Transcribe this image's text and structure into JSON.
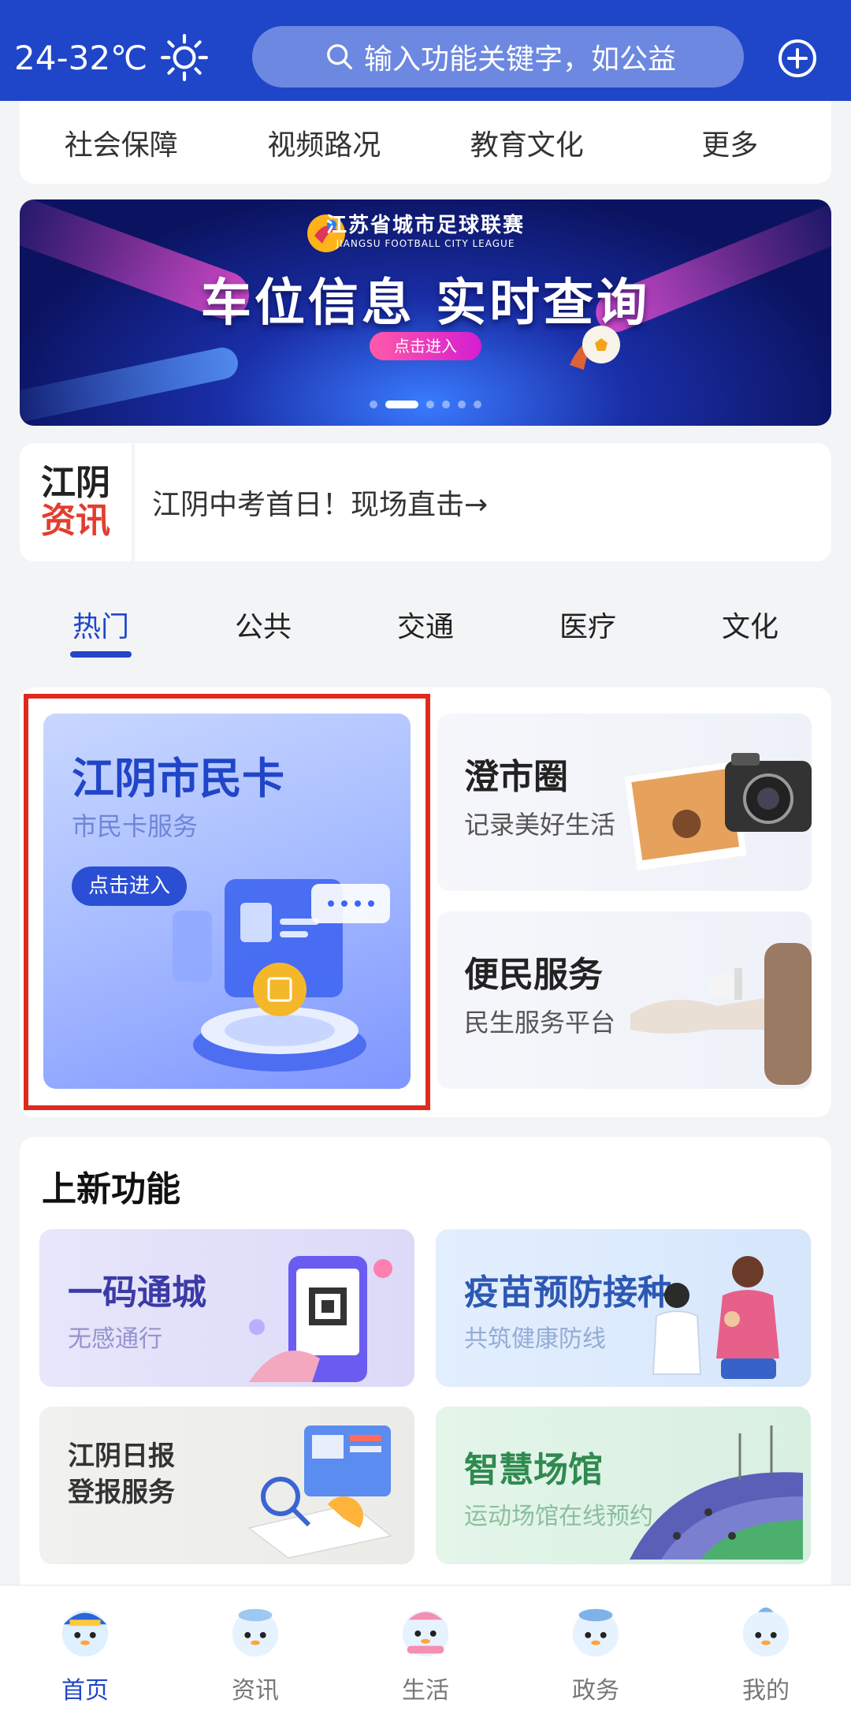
{
  "header": {
    "weather": "24-32℃",
    "search_placeholder": "输入功能关键字，如公益"
  },
  "top_categories": [
    "社会保障",
    "视频路况",
    "教育文化",
    "更多"
  ],
  "banner": {
    "league_cn": "江苏省城市足球联赛",
    "league_en": "JIANGSU FOOTBALL CITY LEAGUE",
    "title": "车位信息 实时查询",
    "button": "点击进入",
    "slide_count": 6,
    "active_slide": 2
  },
  "news": {
    "logo_line1": "江阴",
    "logo_line2": "资讯",
    "headline": "江阴中考首日！现场直击→"
  },
  "tabs": [
    {
      "label": "热门",
      "active": true
    },
    {
      "label": "公共",
      "active": false
    },
    {
      "label": "交通",
      "active": false
    },
    {
      "label": "医疗",
      "active": false
    },
    {
      "label": "文化",
      "active": false
    }
  ],
  "featured": {
    "citizen_card": {
      "title": "江阴市民卡",
      "subtitle": "市民卡服务",
      "button": "点击进入"
    },
    "chengshiquan": {
      "title": "澄市圈",
      "subtitle": "记录美好生活"
    },
    "bianmin": {
      "title": "便民服务",
      "subtitle": "民生服务平台"
    }
  },
  "new_functions": {
    "section_title": "上新功能",
    "cards": [
      {
        "title": "一码通城",
        "subtitle": "无感通行"
      },
      {
        "title": "疫苗预防接种",
        "subtitle": "共筑健康防线"
      },
      {
        "title_line1": "江阴日报",
        "title_line2": "登报服务"
      },
      {
        "title": "智慧场馆",
        "subtitle": "运动场馆在线预约"
      }
    ]
  },
  "bottom_nav": [
    {
      "label": "首页",
      "active": true
    },
    {
      "label": "资讯",
      "active": false
    },
    {
      "label": "生活",
      "active": false
    },
    {
      "label": "政务",
      "active": false
    },
    {
      "label": "我的",
      "active": false
    }
  ],
  "colors": {
    "primary": "#1f45c9",
    "highlight_border": "#e02a1f"
  }
}
